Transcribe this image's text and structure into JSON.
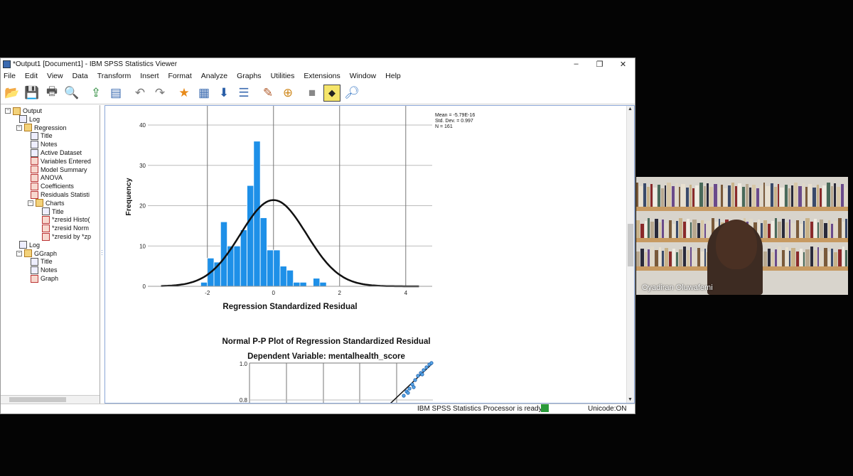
{
  "window": {
    "title": "*Output1 [Document1] - IBM SPSS Statistics Viewer",
    "controls": [
      "–",
      "❐",
      "✕"
    ]
  },
  "menu": [
    "File",
    "Edit",
    "View",
    "Data",
    "Transform",
    "Insert",
    "Format",
    "Analyze",
    "Graphs",
    "Utilities",
    "Extensions",
    "Window",
    "Help"
  ],
  "toolbar_icons": [
    "open-icon",
    "save-icon",
    "print-icon",
    "print-preview-icon",
    "export-icon",
    "recall-dialog-icon",
    "undo-icon",
    "redo-icon",
    "goto-data-icon",
    "goto-case-icon",
    "goto-variable-icon",
    "variables-icon",
    "create-title-icon",
    "insert-output-icon",
    "hide-icon",
    "show-icon",
    "find-icon"
  ],
  "outline": {
    "items": [
      {
        "label": "Output",
        "level": 0,
        "kind": "book"
      },
      {
        "label": "Log",
        "level": 1,
        "kind": "doc"
      },
      {
        "label": "Regression",
        "level": 1,
        "kind": "book"
      },
      {
        "label": "Title",
        "level": 2,
        "kind": "doc"
      },
      {
        "label": "Notes",
        "level": 2,
        "kind": "doc"
      },
      {
        "label": "Active Dataset",
        "level": 2,
        "kind": "doc"
      },
      {
        "label": "Variables Entered",
        "level": 2,
        "kind": "red"
      },
      {
        "label": "Model Summary",
        "level": 2,
        "kind": "red"
      },
      {
        "label": "ANOVA",
        "level": 2,
        "kind": "red"
      },
      {
        "label": "Coefficients",
        "level": 2,
        "kind": "red"
      },
      {
        "label": "Residuals Statisti",
        "level": 2,
        "kind": "red"
      },
      {
        "label": "Charts",
        "level": 2,
        "kind": "book"
      },
      {
        "label": "Title",
        "level": 3,
        "kind": "doc"
      },
      {
        "label": "*zresid Histo(",
        "level": 3,
        "kind": "red"
      },
      {
        "label": "*zresid Norm",
        "level": 3,
        "kind": "red"
      },
      {
        "label": "*zresid by *zp",
        "level": 3,
        "kind": "red"
      },
      {
        "label": "Log",
        "level": 1,
        "kind": "doc"
      },
      {
        "label": "GGraph",
        "level": 1,
        "kind": "book"
      },
      {
        "label": "Title",
        "level": 2,
        "kind": "doc"
      },
      {
        "label": "Notes",
        "level": 2,
        "kind": "doc"
      },
      {
        "label": "Graph",
        "level": 2,
        "kind": "red"
      }
    ]
  },
  "status": {
    "processor": "IBM SPSS Statistics Processor is ready",
    "unicode": "Unicode:ON"
  },
  "video": {
    "participant_name": "Oyadiran Oluwafemi"
  },
  "chart_data": [
    {
      "type": "bar",
      "subtype": "histogram",
      "xlabel": "Regression Standardized Residual",
      "ylabel": "Frequency",
      "ylim": [
        0,
        43
      ],
      "xlim": [
        -3.8,
        4.8
      ],
      "yticks": [
        0,
        10,
        20,
        30,
        40
      ],
      "xticks": [
        -2,
        0,
        2,
        4
      ],
      "bin_width": 0.2,
      "bins_start": [
        -2.2,
        -2.0,
        -1.8,
        -1.6,
        -1.4,
        -1.2,
        -1.0,
        -0.8,
        -0.6,
        -0.4,
        -0.2,
        0.0,
        0.2,
        0.4,
        0.6,
        0.8,
        1.0,
        1.2,
        1.4,
        1.6,
        1.8,
        2.0,
        2.2,
        2.4,
        2.6,
        2.8,
        3.0
      ],
      "values": [
        1,
        7,
        6,
        16,
        10,
        10,
        14,
        25,
        36,
        17,
        9,
        9,
        5,
        4,
        1,
        1,
        0,
        2,
        1,
        0,
        0,
        0,
        0,
        0,
        0,
        0,
        0
      ],
      "normal_curve": {
        "mean": 0,
        "sd": 0.997,
        "n": 161,
        "peak": 21.4
      },
      "legend_text": [
        "Mean = -5.79E-16",
        "Std. Dev. = 0.997",
        "N = 161"
      ],
      "grid": true
    },
    {
      "type": "scatter",
      "title": "Normal P-P Plot of Regression Standardized Residual",
      "subtitle": "Dependent Variable: mentalhealth_score",
      "yticks": [
        "1.0",
        "0.8"
      ],
      "note": "partially visible"
    }
  ]
}
